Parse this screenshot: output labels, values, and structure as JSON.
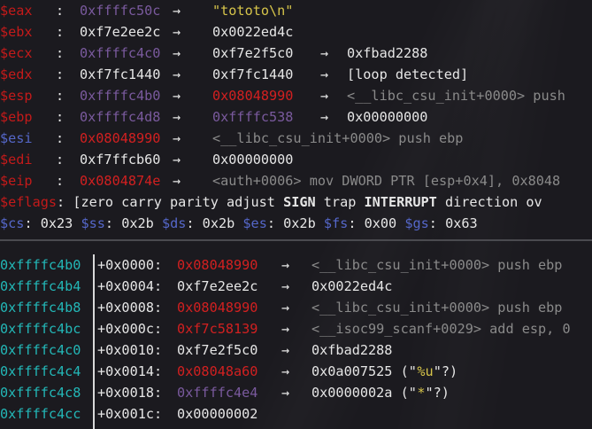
{
  "colors": {
    "background": "#1b1a1f",
    "text": "#e6e6e6",
    "reg_name": "#c41a1a",
    "reg_name_alt": "#5567c9",
    "addr_stack": "#7a5a9e",
    "addr_code": "#d22020",
    "addr_plain": "#e6e6e6",
    "string": "#d6c44a",
    "comment": "#8a8a8a",
    "stack_addr": "#23b7b7",
    "seg_name": "#5567c9"
  },
  "registers": [
    {
      "name": "$eax",
      "name_color": "reg_name",
      "addr": "0xffffc50c",
      "addr_color": "addr_stack",
      "chain": [
        {
          "t": "→",
          "c": "text"
        },
        {
          "t": "\"tototo\\n\"",
          "c": "string"
        }
      ]
    },
    {
      "name": "$ebx",
      "name_color": "reg_name",
      "addr": "0xf7e2ee2c",
      "addr_color": "addr_plain",
      "chain": [
        {
          "t": "→",
          "c": "text"
        },
        {
          "t": "0x0022ed4c",
          "c": "addr_plain"
        }
      ]
    },
    {
      "name": "$ecx",
      "name_color": "reg_name",
      "addr": "0xffffc4c0",
      "addr_color": "addr_stack",
      "chain": [
        {
          "t": "→",
          "c": "text"
        },
        {
          "t": "0xf7e2f5c0",
          "c": "addr_plain"
        },
        {
          "t": "→",
          "c": "text"
        },
        {
          "t": "0xfbad2288",
          "c": "addr_plain"
        }
      ]
    },
    {
      "name": "$edx",
      "name_color": "reg_name",
      "addr": "0xf7fc1440",
      "addr_color": "addr_plain",
      "chain": [
        {
          "t": "→",
          "c": "text"
        },
        {
          "t": "0xf7fc1440",
          "c": "addr_plain"
        },
        {
          "t": "→",
          "c": "text"
        },
        {
          "t": "[loop detected]",
          "c": "addr_plain"
        }
      ]
    },
    {
      "name": "$esp",
      "name_color": "reg_name",
      "addr": "0xffffc4b0",
      "addr_color": "addr_stack",
      "chain": [
        {
          "t": "→",
          "c": "text"
        },
        {
          "t": "0x08048990",
          "c": "addr_code"
        },
        {
          "t": "→",
          "c": "text"
        },
        {
          "t": "<__libc_csu_init+0000> push",
          "c": "comment"
        }
      ]
    },
    {
      "name": "$ebp",
      "name_color": "reg_name",
      "addr": "0xffffc4d8",
      "addr_color": "addr_stack",
      "chain": [
        {
          "t": "→",
          "c": "text"
        },
        {
          "t": "0xffffc538",
          "c": "addr_stack"
        },
        {
          "t": "→",
          "c": "text"
        },
        {
          "t": "0x00000000",
          "c": "addr_plain"
        }
      ]
    },
    {
      "name": "$esi",
      "name_color": "reg_name_alt",
      "addr": "0x08048990",
      "addr_color": "addr_code",
      "chain": [
        {
          "t": "→",
          "c": "text"
        },
        {
          "t": "<__libc_csu_init+0000> push ebp",
          "c": "comment"
        }
      ]
    },
    {
      "name": "$edi",
      "name_color": "reg_name",
      "addr": "0xf7ffcb60",
      "addr_color": "addr_plain",
      "chain": [
        {
          "t": "→",
          "c": "text"
        },
        {
          "t": "0x00000000",
          "c": "addr_plain"
        }
      ]
    },
    {
      "name": "$eip",
      "name_color": "reg_name",
      "addr": "0x0804874e",
      "addr_color": "addr_code",
      "chain": [
        {
          "t": "→",
          "c": "text"
        },
        {
          "t": "<auth+0006> mov DWORD PTR [esp+0x4], 0x8048",
          "c": "comment"
        }
      ]
    }
  ],
  "eflags": {
    "name": "$eflags",
    "parts": [
      {
        "t": "[zero carry parity adjust ",
        "b": false
      },
      {
        "t": "SIGN",
        "b": true
      },
      {
        "t": " trap ",
        "b": false
      },
      {
        "t": "INTERRUPT",
        "b": true
      },
      {
        "t": " direction ov",
        "b": false
      }
    ]
  },
  "segments": [
    {
      "name": "$cs",
      "value": "0x23"
    },
    {
      "name": "$ss",
      "value": "0x2b"
    },
    {
      "name": "$ds",
      "value": "0x2b"
    },
    {
      "name": "$es",
      "value": "0x2b"
    },
    {
      "name": "$fs",
      "value": "0x00"
    },
    {
      "name": "$gs",
      "value": "0x63"
    }
  ],
  "stack": [
    {
      "addr": "0xffffc4b0",
      "offset": "+0x0000:",
      "value": "0x08048990",
      "value_color": "addr_code",
      "chain": [
        {
          "t": "→",
          "c": "text"
        },
        {
          "t": "<__libc_csu_init+0000> push ebp",
          "c": "comment"
        }
      ]
    },
    {
      "addr": "0xffffc4b4",
      "offset": "+0x0004:",
      "value": "0xf7e2ee2c",
      "value_color": "addr_plain",
      "chain": [
        {
          "t": "→",
          "c": "text"
        },
        {
          "t": "0x0022ed4c",
          "c": "addr_plain"
        }
      ]
    },
    {
      "addr": "0xffffc4b8",
      "offset": "+0x0008:",
      "value": "0x08048990",
      "value_color": "addr_code",
      "chain": [
        {
          "t": "→",
          "c": "text"
        },
        {
          "t": "<__libc_csu_init+0000> push ebp",
          "c": "comment"
        }
      ]
    },
    {
      "addr": "0xffffc4bc",
      "offset": "+0x000c:",
      "value": "0xf7c58139",
      "value_color": "addr_code",
      "chain": [
        {
          "t": "→",
          "c": "text"
        },
        {
          "t": "<__isoc99_scanf+0029> add esp, 0",
          "c": "comment"
        }
      ]
    },
    {
      "addr": "0xffffc4c0",
      "offset": "+0x0010:",
      "value": "0xf7e2f5c0",
      "value_color": "addr_plain",
      "chain": [
        {
          "t": "→",
          "c": "text"
        },
        {
          "t": "0xfbad2288",
          "c": "addr_plain"
        }
      ]
    },
    {
      "addr": "0xffffc4c4",
      "offset": "+0x0014:",
      "value": "0x08048a60",
      "value_color": "addr_code",
      "chain": [
        {
          "t": "→",
          "c": "text"
        },
        {
          "t": "0x0a007525 (\"",
          "c": "addr_plain"
        },
        {
          "t": "%u",
          "c": "string"
        },
        {
          "t": "\"?)",
          "c": "addr_plain"
        }
      ]
    },
    {
      "addr": "0xffffc4c8",
      "offset": "+0x0018:",
      "value": "0xffffc4e4",
      "value_color": "addr_stack",
      "chain": [
        {
          "t": "→",
          "c": "text"
        },
        {
          "t": "0x0000002a (\"",
          "c": "addr_plain"
        },
        {
          "t": "*",
          "c": "string"
        },
        {
          "t": "\"?)",
          "c": "addr_plain"
        }
      ]
    },
    {
      "addr": "0xffffc4cc",
      "offset": "+0x001c:",
      "value": "0x00000002",
      "value_color": "addr_plain",
      "chain": []
    }
  ]
}
